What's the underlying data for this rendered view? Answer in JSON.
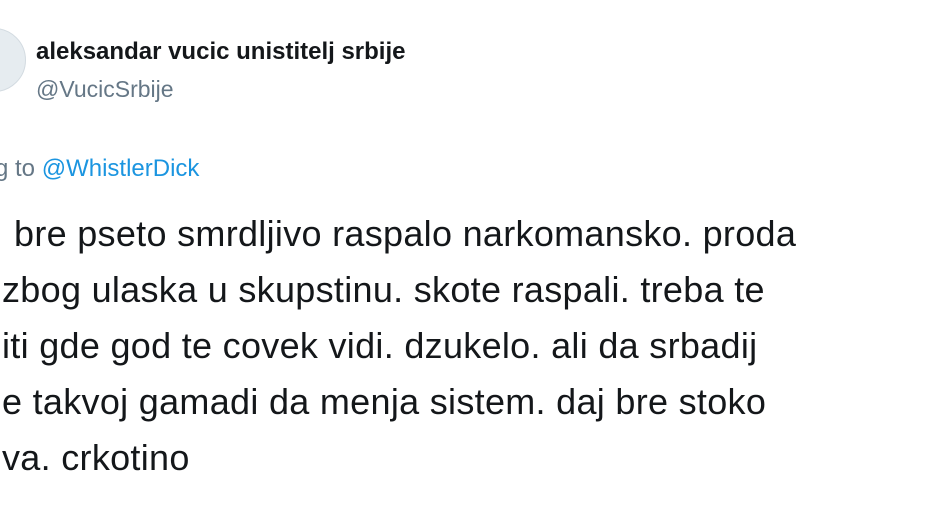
{
  "author": {
    "display_name": "aleksandar vucic unistitelj srbije",
    "handle": "@VucicSrbije",
    "avatar_icon": "avatar-circle"
  },
  "reply": {
    "prefix": "g to",
    "mention": "@WhistlerDick"
  },
  "tweet": {
    "lines": [
      "bre pseto smrdljivo raspalo narkomansko. proda",
      "zbog ulaska u skupstinu. skote raspali. treba te",
      "iti gde god te covek vidi. dzukelo. ali da srbadij",
      "e takvoj gamadi da menja sistem. daj bre stoko",
      "va. crkotino"
    ]
  },
  "colors": {
    "text": "#14171a",
    "muted": "#657786",
    "link": "#1b95e0"
  }
}
